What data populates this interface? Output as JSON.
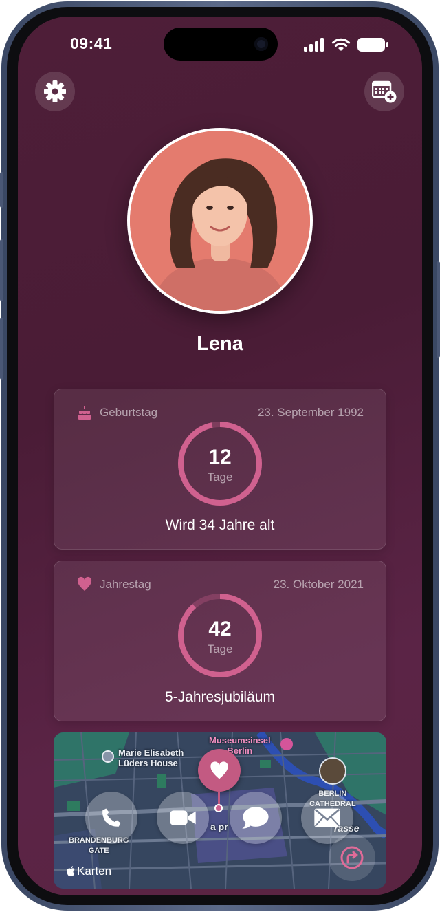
{
  "status_bar": {
    "time": "09:41"
  },
  "top_bar": {
    "settings_icon": "gear-icon",
    "calendar_icon": "calendar-add-icon"
  },
  "profile": {
    "name": "Lena"
  },
  "birthday_card": {
    "label": "Geburtstag",
    "date": "23. September 1992",
    "days": "12",
    "unit": "Tage",
    "caption": "Wird 34 Jahre alt",
    "icon": "cake-icon",
    "progress": 0.967
  },
  "anniversary_card": {
    "label": "Jahrestag",
    "date": "23. Oktober 2021",
    "days": "42",
    "unit": "Tage",
    "caption": "5-Jahresjubiläum",
    "icon": "heart-icon",
    "progress": 0.885
  },
  "map": {
    "labels": {
      "museum": "Museumsinsel\nBerlin",
      "luders": "Marie Elisabeth\nLüders House",
      "cathedral": "BERLIN\nCATHEDRAL",
      "gate": "BRANDENBURG\nGATE",
      "street": "a pr",
      "street2": "rasse"
    },
    "attribution": "Karten"
  },
  "actions": [
    {
      "name": "call-button",
      "icon": "phone-icon"
    },
    {
      "name": "video-button",
      "icon": "video-icon"
    },
    {
      "name": "message-button",
      "icon": "message-icon"
    },
    {
      "name": "mail-button",
      "icon": "mail-icon"
    }
  ],
  "colors": {
    "accent": "#d0618f",
    "background": "#4e1e38"
  }
}
